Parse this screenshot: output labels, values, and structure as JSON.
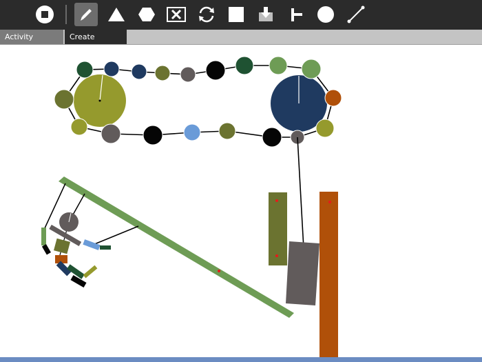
{
  "tabs": {
    "activity": "Activity",
    "create": "Create"
  },
  "colors": {
    "toolbar": "#2b2b2b",
    "active_tool": "#6d6d6d",
    "tab_bar": "#c4c4c4",
    "activity_tab": "#7b7b7b",
    "create_tab": "#2b2b2b",
    "bottom_bar": "#6b8cc2",
    "joint": "#e81a1a"
  },
  "toolbar": {
    "tools": [
      {
        "name": "stop-icon",
        "active": false
      },
      {
        "name": "pencil-icon",
        "active": true
      },
      {
        "name": "triangle-icon",
        "active": false
      },
      {
        "name": "hexagon-icon",
        "active": false
      },
      {
        "name": "delete-icon",
        "active": false
      },
      {
        "name": "rotate-icon",
        "active": false
      },
      {
        "name": "square-icon",
        "active": false
      },
      {
        "name": "download-icon",
        "active": false
      },
      {
        "name": "joint-icon",
        "active": false
      },
      {
        "name": "circle-icon",
        "active": false
      },
      {
        "name": "line-icon",
        "active": false
      }
    ]
  }
}
